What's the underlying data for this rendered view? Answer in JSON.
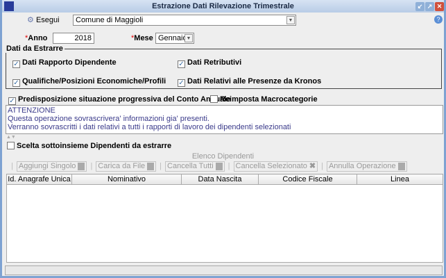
{
  "window": {
    "title": "Estrazione Dati Rilevazione Trimestrale"
  },
  "toolbar": {
    "run_label": "Esegui",
    "ente_value": "Comune di Maggioli"
  },
  "form": {
    "anno_label": "Anno",
    "anno_value": "2018",
    "mese_label": "Mese",
    "mese_value": "Gennaio"
  },
  "dati": {
    "legend": "Dati da Estrarre",
    "items": [
      {
        "label": "Dati Rapporto Dipendente",
        "checked": true
      },
      {
        "label": "Dati Retributivi",
        "checked": true
      },
      {
        "label": "Qualifiche/Posizioni Economiche/Profili",
        "checked": true
      },
      {
        "label": "Dati Relativi alle Presenze da Kronos",
        "checked": true
      }
    ]
  },
  "options": {
    "predisposizione": "Predisposizione situazione progressiva del Conto Annuale",
    "reimposta": "Reimposta Macrocategorie"
  },
  "message": {
    "title": "ATTENZIONE",
    "line1": "Questa operazione sovrascrivera' informazioni gia' presenti.",
    "line2": "Verranno sovrascritti i dati relativi a tutti i rapporti di lavoro dei dipendenti selezionati"
  },
  "subset": {
    "label": "Scelta sottoinsieme Dipendenti da estrarre"
  },
  "list": {
    "title": "Elenco Dipendenti",
    "buttons": [
      "Aggiungi Singolo",
      "Carica da File",
      "Cancella Tutti",
      "Cancella Selezionato",
      "Annulla Operazione"
    ],
    "columns": [
      "Id. Anagrafe Unica",
      "Nominativo",
      "Data Nascita",
      "Codice Fiscale",
      "Linea"
    ]
  }
}
